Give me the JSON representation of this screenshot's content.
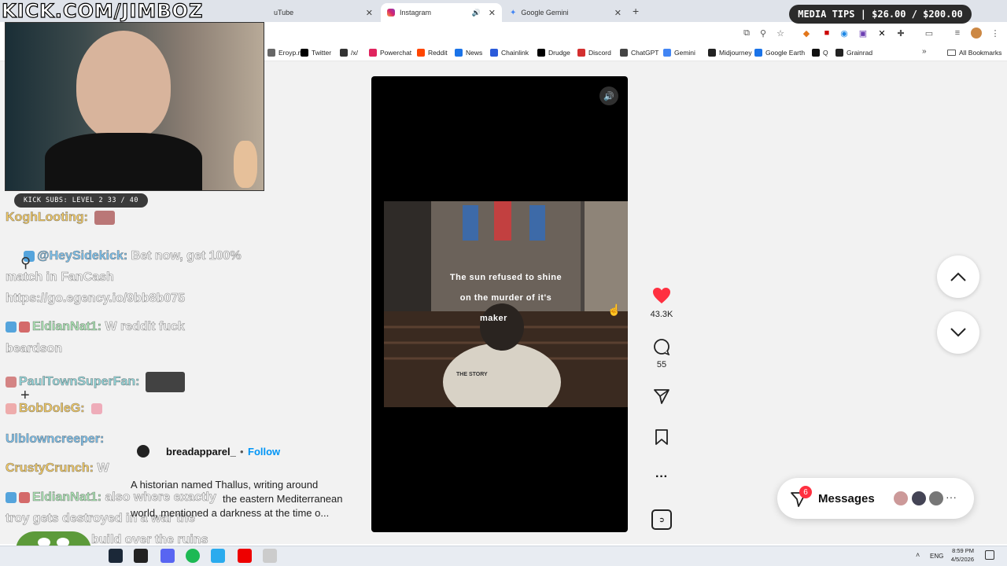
{
  "tabs": [
    {
      "label": "uTube",
      "active": false
    },
    {
      "label": "Instagram",
      "active": true
    },
    {
      "label": "Google Gemini",
      "active": false
    }
  ],
  "new_tab_label": "+",
  "bookmarks": [
    {
      "label": "Eroyp.me",
      "color": "#666"
    },
    {
      "label": "Twitter",
      "color": "#000"
    },
    {
      "label": "/x/",
      "color": "#333"
    },
    {
      "label": "Powerchat",
      "color": "#e0245e"
    },
    {
      "label": "Reddit",
      "color": "#ff4500"
    },
    {
      "label": "News",
      "color": "#1a73e8"
    },
    {
      "label": "Chainlink",
      "color": "#2a5ada"
    },
    {
      "label": "Drudge",
      "color": "#000"
    },
    {
      "label": "Discord",
      "color": "#d32f2f"
    },
    {
      "label": "ChatGPT",
      "color": "#444"
    },
    {
      "label": "Gemini",
      "color": "#4285f4"
    },
    {
      "label": "Midjourney",
      "color": "#222"
    },
    {
      "label": "Google Earth",
      "color": "#1a73e8"
    },
    {
      "label": "Q",
      "color": "#111"
    },
    {
      "label": "Grainrad",
      "color": "#222"
    }
  ],
  "all_bookmarks": "All Bookmarks",
  "stream": {
    "logo": "KICK.COM/JIMBOZ",
    "subs": "KICK SUBS: LEVEL 2 33 / 40",
    "tips": "MEDIA TIPS | $26.00 / $200.00"
  },
  "chat": [
    {
      "user": "KoghLooting:",
      "text": "",
      "cls": "y"
    },
    {
      "user": "@HeySidekick:",
      "text": " Bet now, get 100%",
      "cls": "b"
    },
    {
      "user": "",
      "text": "match in FanCash",
      "cls": ""
    },
    {
      "user": "",
      "text": "https://go.egency.io/9bb8b075",
      "cls": ""
    },
    {
      "user": "EldianNat1:",
      "text": " W reddit fuck",
      "cls": "n"
    },
    {
      "user": "",
      "text": "beardson",
      "cls": ""
    },
    {
      "user": "PaulTownSuperFan:",
      "text": "",
      "cls": "m"
    },
    {
      "user": "BobDoleG:",
      "text": "",
      "cls": "y"
    },
    {
      "user": "Ulblowncreeper:",
      "text": "",
      "cls": "b"
    },
    {
      "user": "CrustyCrunch:",
      "text": " W",
      "cls": "y"
    },
    {
      "user": "EldianNat1:",
      "text": " also where exactly",
      "cls": "n"
    },
    {
      "user": "",
      "text": "troy gets destroyed in a war the",
      "cls": ""
    },
    {
      "user": "",
      "text": "build over the ruins",
      "cls": ""
    }
  ],
  "reel": {
    "caption_lines": [
      "The sun refused to shine",
      "on the murder of it's",
      "maker"
    ],
    "shirt_text": "THE STORY",
    "likes": "43.3K",
    "comments": "55",
    "author": "breadapparel_",
    "follow": "Follow",
    "separator": "•",
    "description_1": "A historian named Thallus, writing around",
    "description_2": "the eastern Mediterranean",
    "description_3": "world, mentioned a darkness at the time o..."
  },
  "messages": {
    "label": "Messages",
    "badge": "6"
  },
  "taskbar": {
    "lang": "ENG",
    "time": "8:59 PM",
    "date": "4/5/2026"
  }
}
